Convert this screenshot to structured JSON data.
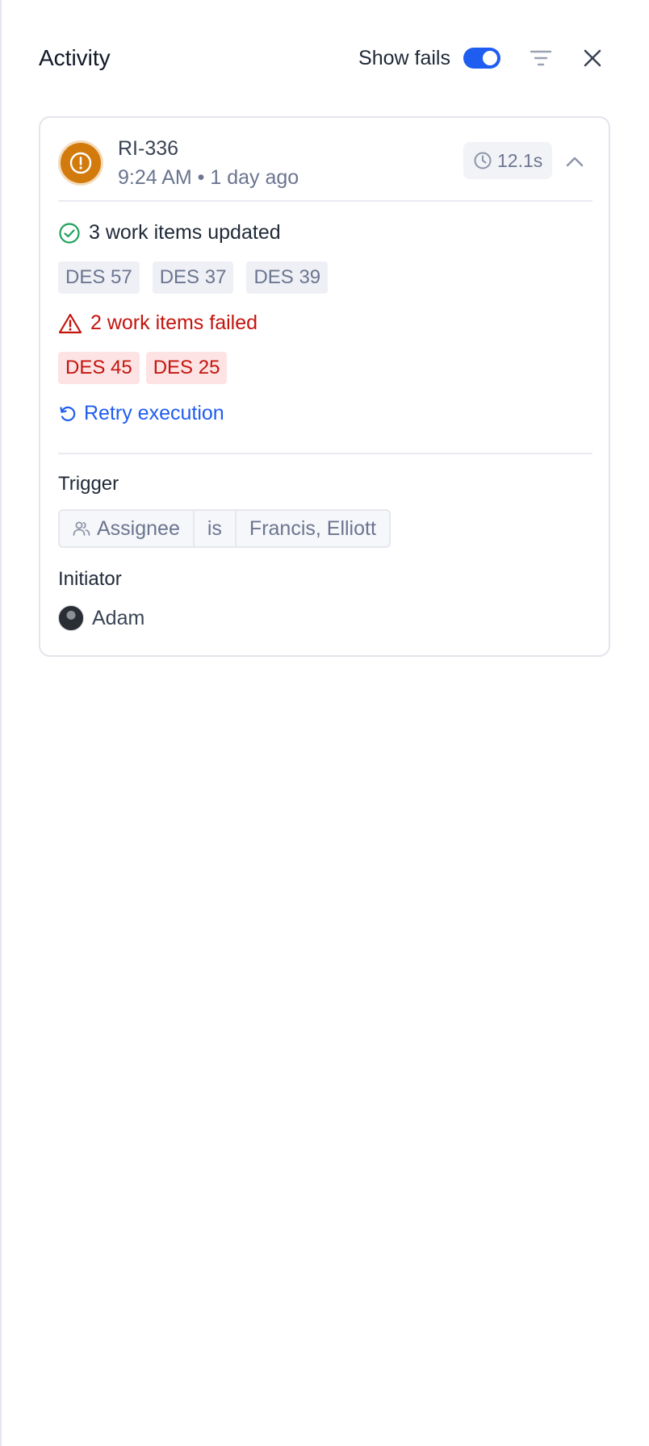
{
  "header": {
    "title": "Activity",
    "show_fails_label": "Show fails",
    "show_fails_on": true
  },
  "run": {
    "id": "RI-336",
    "time": "9:24 AM • 1 day ago",
    "duration": "12.1s",
    "status_color": "#d27a0b",
    "updated": {
      "label": "3 work items updated",
      "items": [
        "DES 57",
        "DES 37",
        "DES 39"
      ]
    },
    "failed": {
      "label": "2 work items failed",
      "items": [
        "DES 45",
        "DES 25"
      ]
    },
    "retry_label": "Retry execution",
    "trigger": {
      "label": "Trigger",
      "field": "Assignee",
      "operator": "is",
      "value": "Francis, Elliott"
    },
    "initiator": {
      "label": "Initiator",
      "name": "Adam"
    }
  },
  "colors": {
    "accent": "#1f5cf0",
    "error": "#c4140e",
    "success": "#22a05a",
    "warning": "#d27a0b"
  }
}
